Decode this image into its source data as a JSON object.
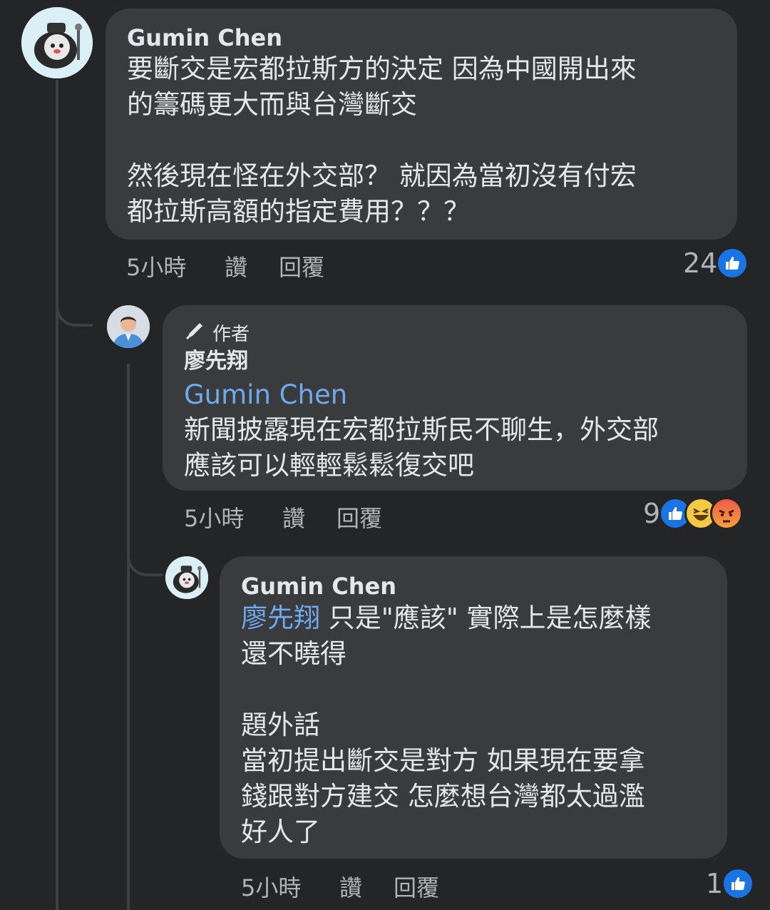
{
  "comments": [
    {
      "author": "Gumin Chen",
      "text": "要斷交是宏都拉斯方的決定 因為中國開出來\n的籌碼更大而與台灣斷交\n\n然後現在怪在外交部？ 就因為當初沒有付宏\n都拉斯高額的指定費用？？？",
      "time": "5小時",
      "like_label": "讚",
      "reply_label": "回覆",
      "reaction_count": "24"
    },
    {
      "badge": "作者",
      "author": "廖先翔",
      "mention": "Gumin Chen",
      "text": "新聞披露現在宏都拉斯民不聊生，外交部\n應該可以輕輕鬆鬆復交吧",
      "time": "5小時",
      "like_label": "讚",
      "reply_label": "回覆",
      "reaction_count": "9"
    },
    {
      "author": "Gumin Chen",
      "mention": "廖先翔",
      "text_first": " 只是\"應該\" 實際上是怎麼樣",
      "text": "還不曉得\n\n題外話\n當初提出斷交是對方 如果現在要拿\n錢跟對方建交 怎麼想台灣都太過濫\n好人了",
      "time": "5小時",
      "like_label": "讚",
      "reply_label": "回覆",
      "reaction_count": "1"
    }
  ],
  "colors": {
    "background": "#242526",
    "bubble": "#3a3b3c",
    "mention": "#6fa9f0",
    "like": "#1b74e4"
  },
  "icons": [
    "thumbs-up-icon",
    "haha-emoji-icon",
    "angry-emoji-icon",
    "pen-icon"
  ]
}
